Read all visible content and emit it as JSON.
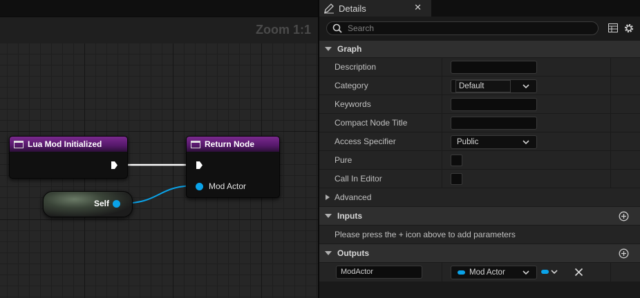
{
  "graph": {
    "zoom_label": "Zoom 1:1",
    "nodes": {
      "lua_mod_initialized": {
        "title": "Lua Mod Initialized"
      },
      "return_node": {
        "title": "Return Node",
        "pins": {
          "mod_actor": "Mod Actor"
        }
      },
      "self": {
        "label": "Self"
      }
    },
    "colors": {
      "exec_wire": "#ffffff",
      "object_wire": "#0aa3e9",
      "function_title": "#6b2180"
    }
  },
  "details": {
    "tab_title": "Details",
    "search": {
      "placeholder": "Search",
      "value": ""
    },
    "sections": {
      "graph": {
        "label": "Graph",
        "rows": {
          "description": {
            "label": "Description",
            "value": ""
          },
          "category": {
            "label": "Category",
            "value": "Default"
          },
          "keywords": {
            "label": "Keywords",
            "value": ""
          },
          "compact_node_title": {
            "label": "Compact Node Title",
            "value": ""
          },
          "access_specifier": {
            "label": "Access Specifier",
            "value": "Public"
          },
          "pure": {
            "label": "Pure"
          },
          "call_in_editor": {
            "label": "Call In Editor"
          }
        }
      },
      "advanced": {
        "label": "Advanced"
      },
      "inputs": {
        "label": "Inputs",
        "hint": "Please press the + icon above to add parameters"
      },
      "outputs": {
        "label": "Outputs",
        "params": [
          {
            "name": "ModActor",
            "type": "Mod Actor"
          }
        ]
      }
    }
  }
}
